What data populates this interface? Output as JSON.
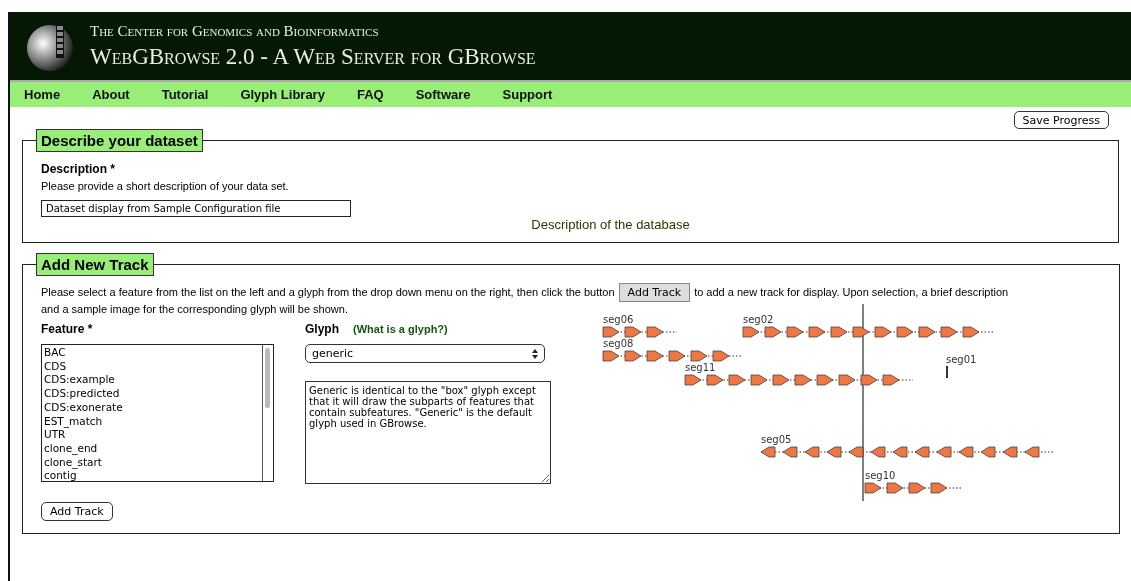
{
  "header": {
    "subtitle": "The Center for Genomics and Bioinformatics",
    "title": "WebGBrowse 2.0 - A Web Server for GBrowse"
  },
  "nav": [
    "Home",
    "About",
    "Tutorial",
    "Glyph Library",
    "FAQ",
    "Software",
    "Support"
  ],
  "save_button": "Save Progress",
  "describe": {
    "legend": "Describe your dataset",
    "label": "Description *",
    "help": "Please provide a short description of your data set.",
    "value": "Dataset display from Sample Configuration file",
    "caption": "Description of the database"
  },
  "add_track": {
    "legend": "Add New Track",
    "intro_before": "Please select a feature from the list on the left and a glyph from the drop down menu on the right, then click the button",
    "intro_button": "Add Track",
    "intro_after": "to add a new track for display. Upon selection, a brief description",
    "intro_line2": "and a sample image for the corresponding glyph will be shown.",
    "feature_label": "Feature *",
    "features": [
      "BAC",
      "CDS",
      "CDS:example",
      "CDS:predicted",
      "CDS:exonerate",
      "EST_match",
      "UTR",
      "clone_end",
      "clone_start",
      "contig"
    ],
    "glyph_label": "Glyph",
    "glyph_link": "(What is a glyph?)",
    "glyph_value": "generic",
    "glyph_description": "Generic is identical to the \"box\" glyph except that it will draw the subparts of features that contain subfeatures. \"Generic\" is the default glyph used in GBrowse.",
    "sample_segments": [
      "seg06",
      "seg02",
      "seg08",
      "seg11",
      "seg01",
      "seg05",
      "seg10"
    ],
    "button": "Add Track"
  }
}
